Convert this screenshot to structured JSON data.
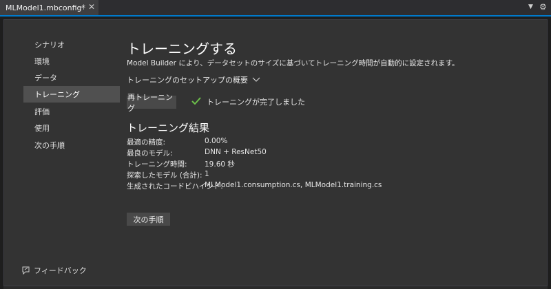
{
  "tab": {
    "title": "MLModel1.mbconfig*",
    "pin_icon": "pin-icon",
    "close_icon": "close-icon"
  },
  "nav": {
    "items": [
      {
        "label": "シナリオ"
      },
      {
        "label": "環境"
      },
      {
        "label": "データ"
      },
      {
        "label": "トレーニング",
        "active": true
      },
      {
        "label": "評価"
      },
      {
        "label": "使用"
      },
      {
        "label": "次の手順"
      }
    ]
  },
  "feedback": {
    "label": "フィードバック",
    "icon": "feedback-icon"
  },
  "main": {
    "title": "トレーニングする",
    "subtitle": "Model Builder により、データセットのサイズに基づいてトレーニング時間が自動的に設定されます。",
    "setup_label": "トレーニングのセットアップの概要",
    "retrain_label": "再トレーニング",
    "status_text": "トレーニングが完了しました",
    "results_title": "トレーニング結果",
    "results": [
      {
        "label": "最適の精度:",
        "value": "0.00%"
      },
      {
        "label": "最良のモデル:",
        "value": "DNN + ResNet50"
      },
      {
        "label": "トレーニング時間:",
        "value": "19.60 秒"
      },
      {
        "label": "探索したモデル (合計):",
        "value": "1"
      },
      {
        "label": "生成されたコードビハインド:",
        "value": "MLModel1.consumption.cs, MLModel1.training.cs"
      }
    ],
    "next_label": "次の手順"
  },
  "colors": {
    "accent": "#007acc",
    "success": "#6cc04a"
  }
}
